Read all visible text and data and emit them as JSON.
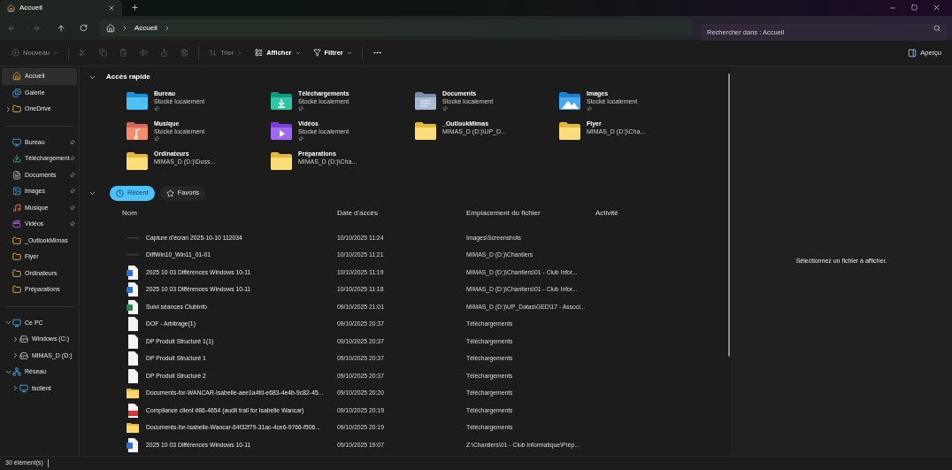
{
  "tabs": [
    {
      "label": "Accueil",
      "selected": true
    }
  ],
  "nav": {
    "breadcrumb": [
      "Accueil"
    ],
    "search": {
      "placeholder": "Rechercher dans : Accueil"
    }
  },
  "toolbar": {
    "items": [
      {
        "kind": "new",
        "label": "Nouveau",
        "disabled": true
      },
      {
        "kind": "cut",
        "disabled": true
      },
      {
        "kind": "copy",
        "disabled": true
      },
      {
        "kind": "paste",
        "disabled": true
      },
      {
        "kind": "rename",
        "disabled": true
      },
      {
        "kind": "share",
        "disabled": true
      },
      {
        "kind": "delete",
        "disabled": true
      },
      {
        "kind": "sort",
        "label": "Trier",
        "disabled": true
      },
      {
        "kind": "view",
        "label": "Afficher",
        "disabled": false
      },
      {
        "kind": "filter",
        "label": "Filtrer",
        "disabled": false
      },
      {
        "kind": "more",
        "disabled": false
      }
    ],
    "preview_toggle": {
      "label": "Aperçu"
    }
  },
  "sidebar": {
    "groups": [
      [
        {
          "label": "Accueil",
          "kind": "home",
          "selected": true
        },
        {
          "label": "Galerie",
          "kind": "gallery",
          "selected": false
        },
        {
          "label": "OneDrive",
          "kind": "folder",
          "selected": false,
          "expanded": false
        }
      ],
      [
        {
          "label": "Bureau",
          "kind": "desktop",
          "selected": false,
          "pinned": true
        },
        {
          "label": "Téléchargement",
          "kind": "download",
          "selected": false,
          "pinned": true
        },
        {
          "label": "Documents",
          "kind": "documents",
          "selected": false,
          "pinned": true
        },
        {
          "label": "Images",
          "kind": "images",
          "selected": false,
          "pinned": true
        },
        {
          "label": "Musique",
          "kind": "music",
          "selected": false,
          "pinned": true
        },
        {
          "label": "Vidéos",
          "kind": "video",
          "selected": false,
          "pinned": true
        },
        {
          "label": "_OutlookMimas",
          "kind": "folder",
          "selected": false,
          "pinned": false
        },
        {
          "label": "Flyer",
          "kind": "folder",
          "selected": false,
          "pinned": false
        },
        {
          "label": "Ordinateurs",
          "kind": "folder",
          "selected": false,
          "pinned": false
        },
        {
          "label": "Préparations",
          "kind": "folder",
          "selected": false,
          "pinned": false
        }
      ],
      [
        {
          "label": "Ce PC",
          "kind": "pc",
          "selected": false,
          "expanded": true,
          "children": [
            {
              "label": "Windows (C:)",
              "kind": "drive",
              "selected": false,
              "expanded": false
            },
            {
              "label": "MIMAS_D (D:)",
              "kind": "drive",
              "selected": false,
              "expanded": false
            }
          ]
        },
        {
          "label": "Réseau",
          "kind": "network",
          "selected": false,
          "expanded": true,
          "children": [
            {
              "label": "tsclient",
              "kind": "pc",
              "selected": false,
              "expanded": false
            }
          ]
        }
      ]
    ]
  },
  "quick_access": {
    "title": "Accès rapide",
    "expanded": true,
    "items": [
      {
        "name": "Bureau",
        "subtitle": "Stocké localement",
        "kind": "desktop",
        "pinned": true
      },
      {
        "name": "Téléchargements",
        "subtitle": "Stocké localement",
        "kind": "download",
        "pinned": true
      },
      {
        "name": "Documents",
        "subtitle": "Stocké localement",
        "kind": "documents",
        "pinned": true
      },
      {
        "name": "Images",
        "subtitle": "Stocké localement",
        "kind": "images",
        "pinned": true
      },
      {
        "name": "Musique",
        "subtitle": "Stocké localement",
        "kind": "music",
        "pinned": true
      },
      {
        "name": "Vidéos",
        "subtitle": "Stocké localement",
        "kind": "video",
        "pinned": true
      },
      {
        "name": "_OutlookMimas",
        "subtitle": "MIMAS_D (D:)\\UP_D...",
        "kind": "folder",
        "pinned": false
      },
      {
        "name": "Flyer",
        "subtitle": "MIMAS_D (D:)\\Cha...",
        "kind": "folder",
        "pinned": false
      },
      {
        "name": "Ordinateurs",
        "subtitle": "MIMAS_D (D:)\\Doss...",
        "kind": "folder",
        "pinned": false
      },
      {
        "name": "Préparations",
        "subtitle": "MIMAS_D (D:)\\Cha...",
        "kind": "folder",
        "pinned": false
      }
    ]
  },
  "recent": {
    "expanded": true,
    "tabs": [
      {
        "label": "Récent",
        "kind": "recent",
        "selected": true
      },
      {
        "label": "Favoris",
        "kind": "favorites",
        "selected": false
      }
    ],
    "columns": [
      "Nom",
      "Date d'accès",
      "Emplacement du fichier",
      "Activité"
    ],
    "rows": [
      {
        "name": "Capture d'écran 2025-10-10 112034",
        "kind": "image",
        "date": "10/10/2025 11:24",
        "location": "Images\\Screenshots"
      },
      {
        "name": "DiffWin10_Win11_01-01",
        "kind": "image",
        "date": "10/10/2025 11:21",
        "location": "MIMAS_D (D:)\\Chantiers"
      },
      {
        "name": "2025 10 03 Différences Windows 10-11",
        "kind": "word",
        "date": "10/10/2025 11:19",
        "location": "MIMAS_D (D:)\\Chantiers\\01 - Club Infor..."
      },
      {
        "name": "2025 10 03 Différences Windows 10-11",
        "kind": "word",
        "date": "10/10/2025 11:18",
        "location": "MIMAS_D (D:)\\Chantiers\\01 - Club Infor..."
      },
      {
        "name": "Suivi séances ClubInfo",
        "kind": "excel",
        "date": "09/10/2025 21:01",
        "location": "MIMAS_D (D:)\\UP_Datas\\GED\\17 - Associ..."
      },
      {
        "name": "DOF - Arbitrage(1)",
        "kind": "blank",
        "date": "09/10/2025 20:37",
        "location": "Téléchargements"
      },
      {
        "name": "DP Produit Structuré 1(1)",
        "kind": "blank",
        "date": "09/10/2025 20:37",
        "location": "Téléchargements"
      },
      {
        "name": "DP Produit Structuré 1",
        "kind": "blank",
        "date": "09/10/2025 20:37",
        "location": "Téléchargements"
      },
      {
        "name": "DP Produit Structuré 2",
        "kind": "blank",
        "date": "09/10/2025 20:37",
        "location": "Téléchargements"
      },
      {
        "name": "Documents-for-WANCAR-Isabelle-aee1a4fd-e683-4e4b-9c82-45...",
        "kind": "folder",
        "date": "09/10/2025 20:20",
        "location": "Téléchargements"
      },
      {
        "name": "Compliance client #86-4654 (audit trail for Isabelle Wancar)",
        "kind": "pdf",
        "date": "09/10/2025 20:19",
        "location": "Téléchargements"
      },
      {
        "name": "Documents-for-Isabelle-Wancar-64f32f79-31ac-4ce6-9766-f506...",
        "kind": "folder",
        "date": "09/10/2025 20:19",
        "location": "Téléchargements"
      },
      {
        "name": "2025 10 03 Différences Windows 10-11",
        "kind": "word",
        "date": "09/10/2025 19:07",
        "location": "Z:\\Chantiers\\01 - Club Informatique\\Prép..."
      }
    ]
  },
  "preview": {
    "message": "Sélectionnez un fichier à afficher."
  },
  "status_bar": {
    "count": "30 élément(s)"
  }
}
